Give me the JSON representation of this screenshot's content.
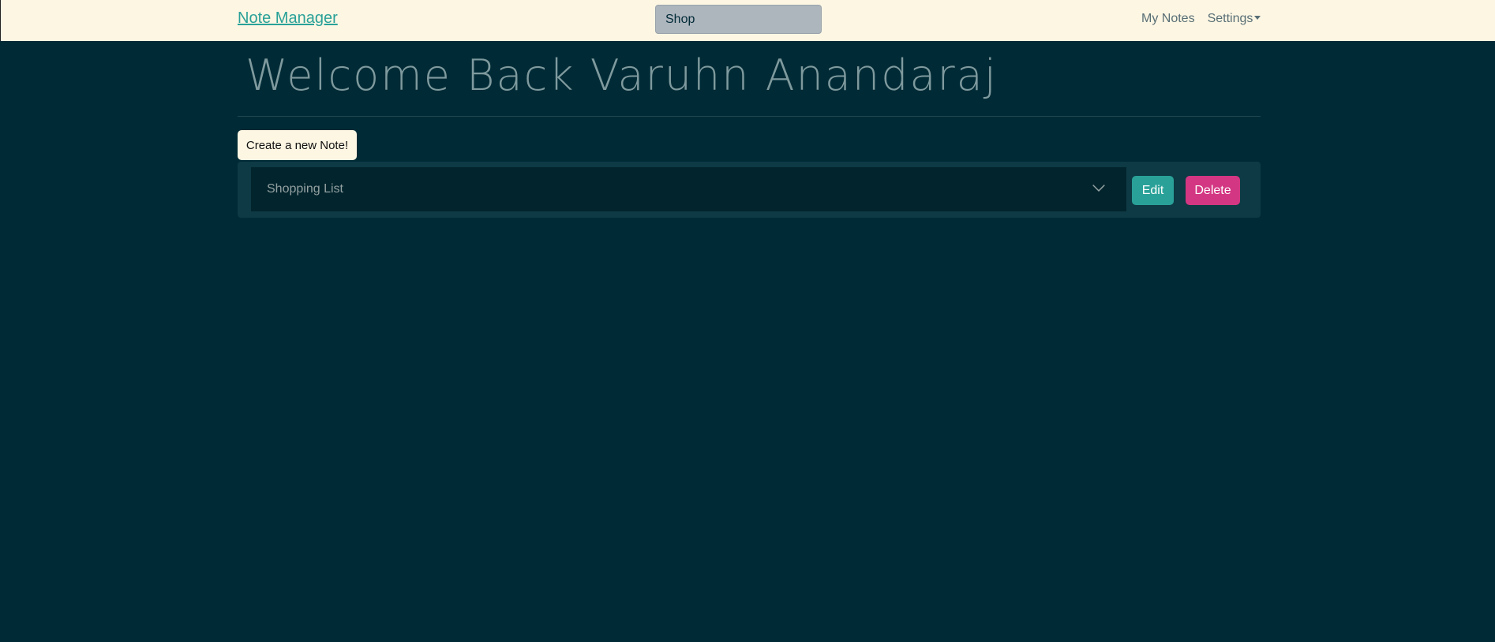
{
  "navbar": {
    "brand": "Note Manager",
    "search_value": "Shop",
    "links": {
      "my_notes": "My Notes",
      "settings": "Settings"
    }
  },
  "main": {
    "welcome": "Welcome Back Varuhn Anandaraj",
    "create_button": "Create a new Note!",
    "notes": [
      {
        "title": "Shopping List",
        "edit_label": "Edit",
        "delete_label": "Delete"
      }
    ]
  },
  "colors": {
    "background": "#002b36",
    "navbar": "#fdf6e3",
    "accent": "#2aa198",
    "danger": "#d33682"
  },
  "icons": {
    "accordion_toggle": "chevron-down-icon",
    "settings_dropdown": "caret-down-icon"
  }
}
